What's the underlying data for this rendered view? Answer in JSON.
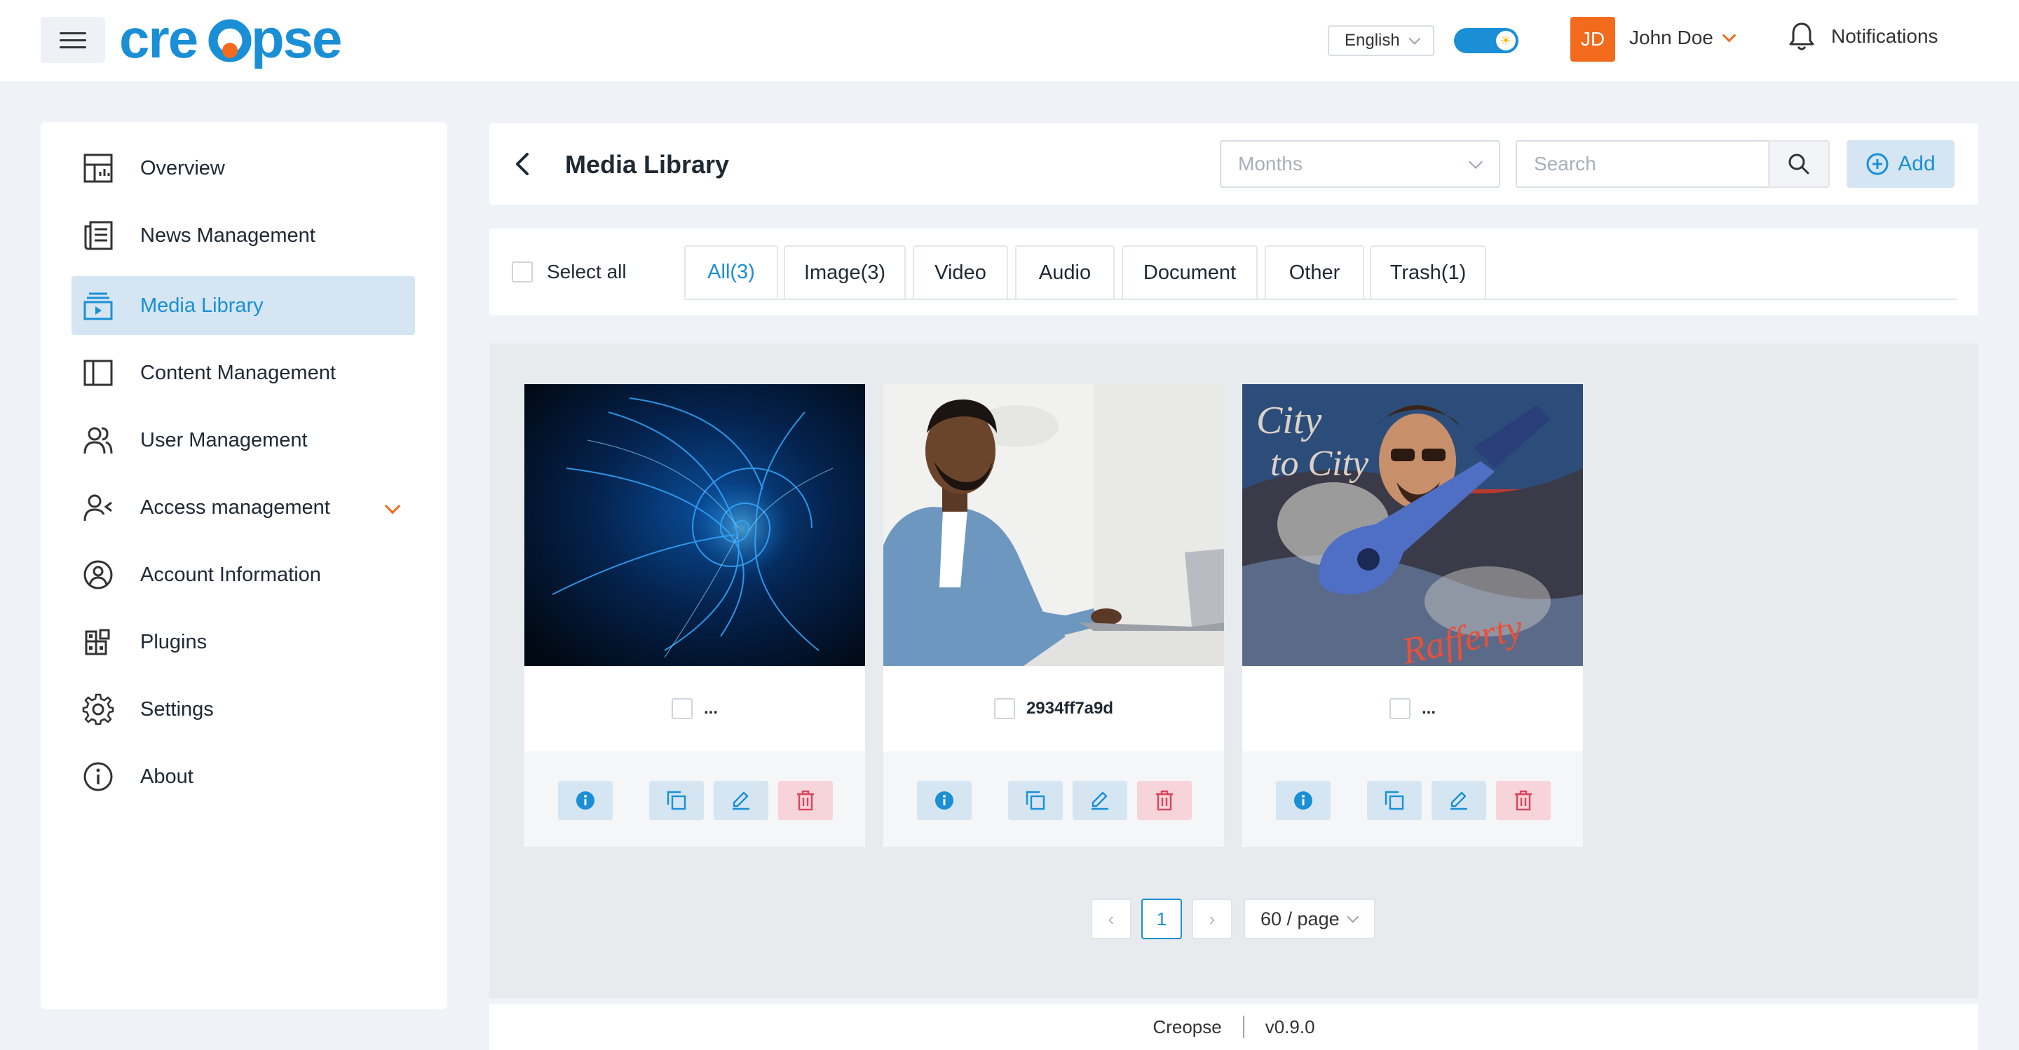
{
  "header": {
    "brand": "creopse",
    "language": "English",
    "user_initials": "JD",
    "user_name": "John Doe",
    "notifications_label": "Notifications"
  },
  "sidebar": {
    "items": [
      {
        "label": "Overview",
        "icon": "overview-icon"
      },
      {
        "label": "News Management",
        "icon": "news-icon"
      },
      {
        "label": "Media Library",
        "icon": "media-icon",
        "active": true
      },
      {
        "label": "Content Management",
        "icon": "content-icon"
      },
      {
        "label": "User Management",
        "icon": "users-icon"
      },
      {
        "label": "Access management",
        "icon": "access-icon",
        "expandable": true
      },
      {
        "label": "Account Information",
        "icon": "account-icon"
      },
      {
        "label": "Plugins",
        "icon": "plugins-icon"
      },
      {
        "label": "Settings",
        "icon": "gear-icon"
      },
      {
        "label": "About",
        "icon": "info-icon"
      }
    ]
  },
  "page": {
    "title": "Media Library",
    "months_placeholder": "Months",
    "search_placeholder": "Search",
    "add_label": "Add"
  },
  "tabs": {
    "select_all": "Select all",
    "items": [
      "All(3)",
      "Image(3)",
      "Video",
      "Audio",
      "Document",
      "Other",
      "Trash(1)"
    ],
    "active": "All(3)"
  },
  "media": [
    {
      "name": "...",
      "image": "blue fractal spiral"
    },
    {
      "name": "2934ff7a9d",
      "image": "man working on laptop"
    },
    {
      "name": "...",
      "image": "City to City album cover"
    }
  ],
  "pagination": {
    "prev": "‹",
    "current": "1",
    "next": "›",
    "per_page": "60 / page"
  },
  "footer": {
    "brand": "Creopse",
    "version": "v0.9.0"
  },
  "colors": {
    "accent": "#1a8fd6",
    "brand_orange": "#f26b1d",
    "danger": "#d9455f"
  }
}
